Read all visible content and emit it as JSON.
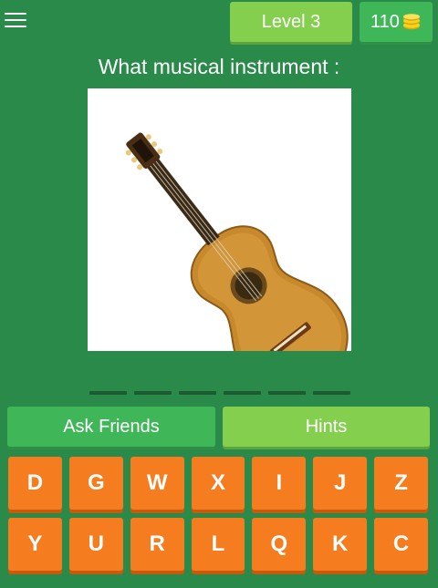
{
  "header": {
    "level_label": "Level 3",
    "coins": "110",
    "menu_icon": "hamburger-menu-icon",
    "coin_icon": "coin-stack-icon"
  },
  "question": {
    "text": "What musical instrument :",
    "image_subject": "acoustic-guitar"
  },
  "answer": {
    "letter_count": 6
  },
  "actions": {
    "ask_friends_label": "Ask Friends",
    "hints_label": "Hints"
  },
  "keyboard": {
    "rows": [
      [
        "D",
        "G",
        "W",
        "X",
        "I",
        "J",
        "Z"
      ],
      [
        "Y",
        "U",
        "R",
        "L",
        "Q",
        "K",
        "C"
      ]
    ]
  },
  "colors": {
    "background": "#2a8a4a",
    "level_badge": "#85cf4f",
    "coin_badge": "#3fb759",
    "key": "#f57c1f",
    "coin": "#f7d21e"
  }
}
